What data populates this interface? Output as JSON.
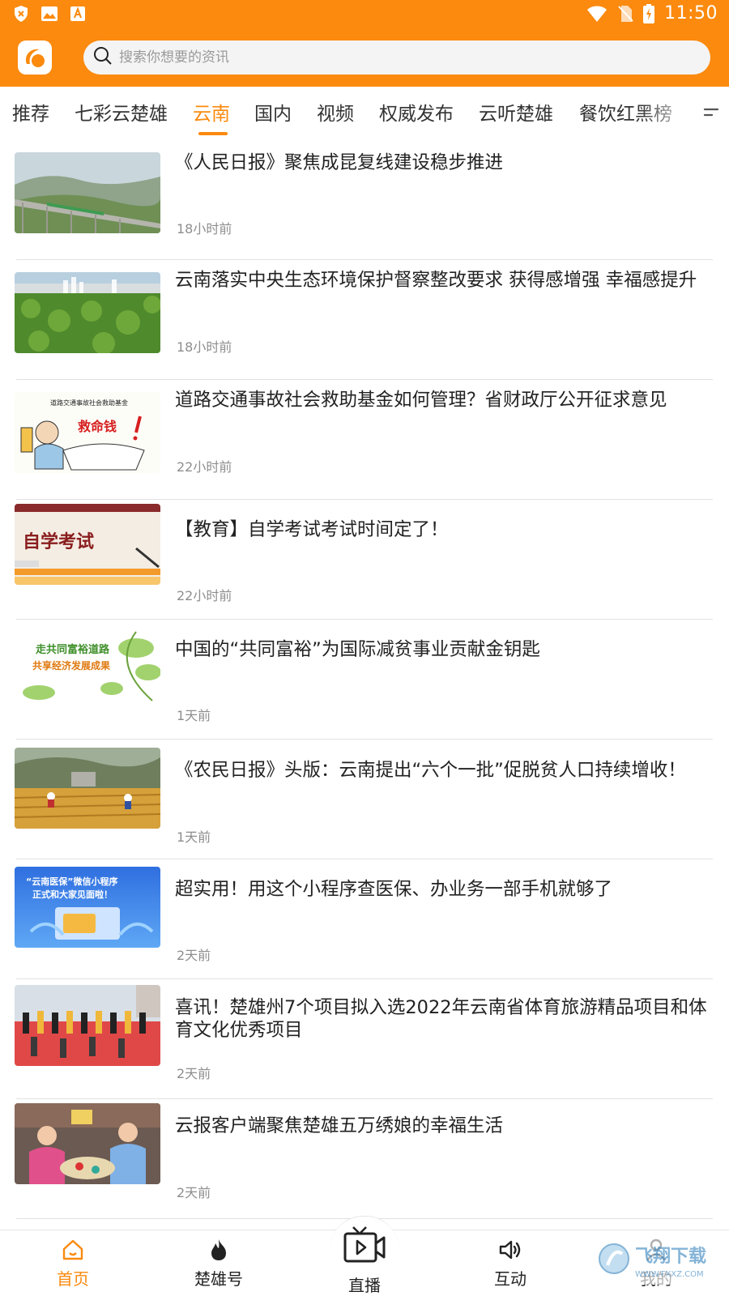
{
  "status_bar": {
    "time": "11:50",
    "left_icons": [
      "shield-icon",
      "image-icon",
      "font-a-icon"
    ],
    "right_icons": [
      "wifi-icon",
      "no-sim-icon",
      "battery-charging-icon"
    ]
  },
  "search": {
    "placeholder": "搜索你想要的资讯"
  },
  "colors": {
    "brand": "#fb8a0e",
    "text": "#222222",
    "meta": "#8e8e8e"
  },
  "tabs": [
    {
      "label": "推荐",
      "active": false
    },
    {
      "label": "七彩云楚雄",
      "active": false
    },
    {
      "label": "云南",
      "active": true
    },
    {
      "label": "国内",
      "active": false
    },
    {
      "label": "视频",
      "active": false
    },
    {
      "label": "权威发布",
      "active": false
    },
    {
      "label": "云听楚雄",
      "active": false
    },
    {
      "label": "餐饮红黑榜",
      "active": false
    }
  ],
  "news": [
    {
      "title": "《人民日报》聚焦成昆复线建设稳步推进",
      "time": "18小时前"
    },
    {
      "title": "云南落实中央生态环境保护督察整改要求 获得感增强 幸福感提升",
      "time": "18小时前"
    },
    {
      "title": "道路交通事故社会救助基金如何管理？省财政厅公开征求意见",
      "time": "22小时前",
      "thumb_text_top": "道路交通事故社会救助基金",
      "thumb_text_main": "救命钱"
    },
    {
      "title": "【教育】自学考试考试时间定了！",
      "time": "22小时前",
      "thumb_text": "自学考试"
    },
    {
      "title": "中国的“共同富裕”为国际减贫事业贡献金钥匙",
      "time": "1天前",
      "thumb_text_1": "走共同富裕道路",
      "thumb_text_2": "共享经济发展成果"
    },
    {
      "title": "《农民日报》头版：云南提出“六个一批”促脱贫人口持续增收！",
      "time": "1天前"
    },
    {
      "title": "超实用！用这个小程序查医保、办业务一部手机就够了",
      "time": "2天前",
      "thumb_text_1": "“云南医保”微信小程序",
      "thumb_text_2": "正式和大家见面啦！"
    },
    {
      "title": "喜讯！楚雄州7个项目拟入选2022年云南省体育旅游精品项目和体育文化优秀项目",
      "time": "2天前"
    },
    {
      "title": "云报客户端聚焦楚雄五万绣娘的幸福生活",
      "time": "2天前"
    }
  ],
  "bottom_nav": [
    {
      "label": "首页",
      "icon": "home-icon",
      "active": true
    },
    {
      "label": "楚雄号",
      "icon": "flame-icon",
      "active": false
    },
    {
      "label": "直播",
      "icon": "live-tv-icon",
      "active": false
    },
    {
      "label": "互动",
      "icon": "speaker-icon",
      "active": false
    },
    {
      "label": "我的",
      "icon": "person-icon",
      "active": false
    }
  ],
  "watermark": {
    "text_main": "飞翔下载",
    "text_url": "WWW.FXXZ.COM"
  }
}
